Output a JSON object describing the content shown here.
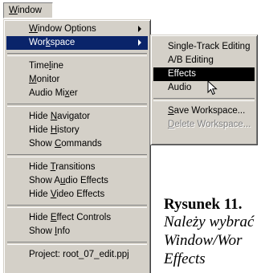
{
  "menubar": {
    "window_label_u": "W",
    "window_label_rest": "indow"
  },
  "window_menu": {
    "groups": [
      {
        "items": [
          {
            "u": "W",
            "rest": "indow Options",
            "submenu": true
          },
          {
            "pre": "Wor",
            "u": "k",
            "rest": "space",
            "submenu": true,
            "highlighted": true
          }
        ]
      },
      {
        "items": [
          {
            "pre": "Time",
            "u": "l",
            "rest": "ine"
          },
          {
            "u": "M",
            "rest": "onitor"
          },
          {
            "pre": "Audio Mi",
            "u": "x",
            "rest": "er"
          }
        ]
      },
      {
        "items": [
          {
            "pre": "Hide ",
            "u": "N",
            "rest": "avigator"
          },
          {
            "pre": "Hide ",
            "u": "H",
            "rest": "istory"
          },
          {
            "pre": "Show ",
            "u": "C",
            "rest": "ommands"
          }
        ]
      },
      {
        "items": [
          {
            "pre": "Hide ",
            "u": "T",
            "rest": "ransitions"
          },
          {
            "pre": "Show A",
            "u": "u",
            "rest": "dio Effects"
          },
          {
            "pre": "Hide ",
            "u": "V",
            "rest": "ideo Effects"
          }
        ]
      },
      {
        "items": [
          {
            "pre": "Hide ",
            "u": "E",
            "rest": "ffect Controls"
          },
          {
            "pre": "Show ",
            "u": "I",
            "rest": "nfo"
          }
        ]
      },
      {
        "items": [
          {
            "pre": "Project: root_07_edit.ppj"
          }
        ]
      }
    ]
  },
  "workspace_submenu": {
    "items": [
      {
        "label": "Single-Track Editing"
      },
      {
        "label": "A/B Editing"
      },
      {
        "label": "Effects",
        "highlighted": true
      },
      {
        "label": "Audio"
      }
    ],
    "save": {
      "u": "S",
      "rest": "ave Workspace..."
    },
    "delete": {
      "u": "D",
      "rest": "elete Workspace..."
    }
  },
  "caption": {
    "title": "Rysunek 11.",
    "line1": "Należy wybrać",
    "line2": "Window/Wor",
    "line3": "Effects"
  },
  "colors": {
    "menu_bg": "#d4d0c8",
    "highlight": "#0a246a",
    "submenu_highlight": "#000000"
  }
}
